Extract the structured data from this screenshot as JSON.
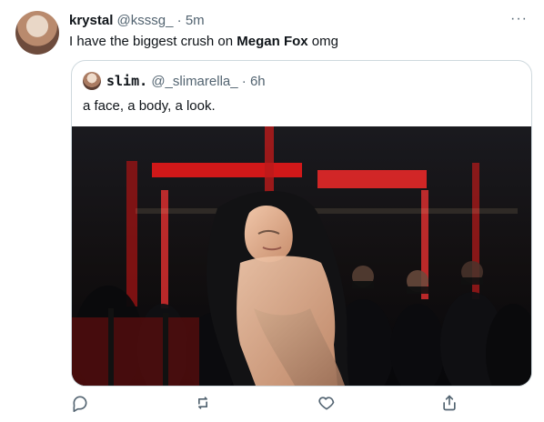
{
  "tweet": {
    "author_name": "krystal",
    "handle": "@ksssg_",
    "separator": "·",
    "time": "5m",
    "text_parts": [
      "I have the biggest crush on ",
      "Megan Fox",
      " omg"
    ],
    "more_label": "···"
  },
  "quote": {
    "author_name": "slim.",
    "handle": "@_slimarella_",
    "separator": "·",
    "time": "6h",
    "text": "a face, a body, a look."
  },
  "actions": {
    "icons": [
      "reply-icon",
      "retweet-icon",
      "like-icon",
      "share-icon"
    ]
  },
  "colors": {
    "muted": "#536471",
    "border": "#cfd9de",
    "accent_red": "#ff2a2a"
  }
}
